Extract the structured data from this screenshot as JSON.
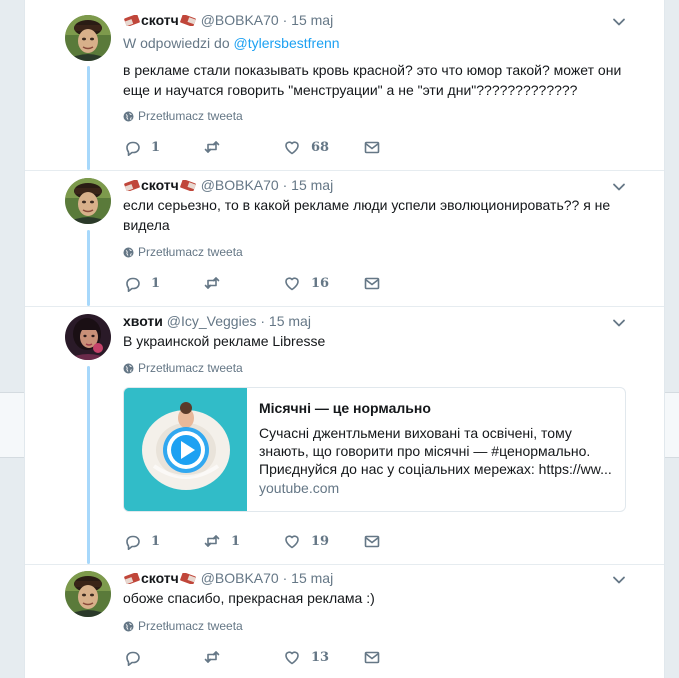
{
  "colors": {
    "accent": "#1da1f2",
    "thread_line": "#a7d8fb",
    "muted": "#657786"
  },
  "tweets": [
    {
      "name": "скотч",
      "handle": "@BOBKA70",
      "date": "· 15 maj",
      "reply_prefix": "W odpowiedzi do",
      "reply_to": "@tylersbestfrenn",
      "text_lines": [
        "в рекламе стали показывать кровь красной? это что юмор такой? может они",
        "еще и научатся говорить \"менструации\" а не \"эти дни\"?????????????"
      ],
      "translate": "Przetłumacz tweeta",
      "replies": "1",
      "retweets": "",
      "likes": "68"
    },
    {
      "name": "скотч",
      "handle": "@BOBKA70",
      "date": "· 15 maj",
      "text_lines": [
        "если серьезно, то в какой рекламе люди успели эволюционировать?? я не",
        "видела"
      ],
      "translate": "Przetłumacz tweeta",
      "replies": "1",
      "retweets": "",
      "likes": "16"
    },
    {
      "name": "хвоти",
      "handle": "@Icy_Veggies",
      "date": "· 15 maj",
      "text_lines": [
        "В украинской рекламе  Libresse"
      ],
      "translate": "Przetłumacz tweeta",
      "replies": "1",
      "retweets": "1",
      "likes": "19",
      "card": {
        "title": "Місячні — це нормально",
        "desc_lines": [
          "Сучасні джентльмени виховані та освічені, тому",
          "знають, що говорити про місячні — #ценормально.",
          "Приєднуйся до нас у соціальних мережах: https://ww..."
        ],
        "domain": "youtube.com"
      }
    },
    {
      "name": "скотч",
      "handle": "@BOBKA70",
      "date": "· 15 maj",
      "text_lines": [
        "обоже спасибо, прекрасная реклама :)"
      ],
      "translate": "Przetłumacz tweeta",
      "replies": "",
      "retweets": "",
      "likes": "13"
    }
  ]
}
